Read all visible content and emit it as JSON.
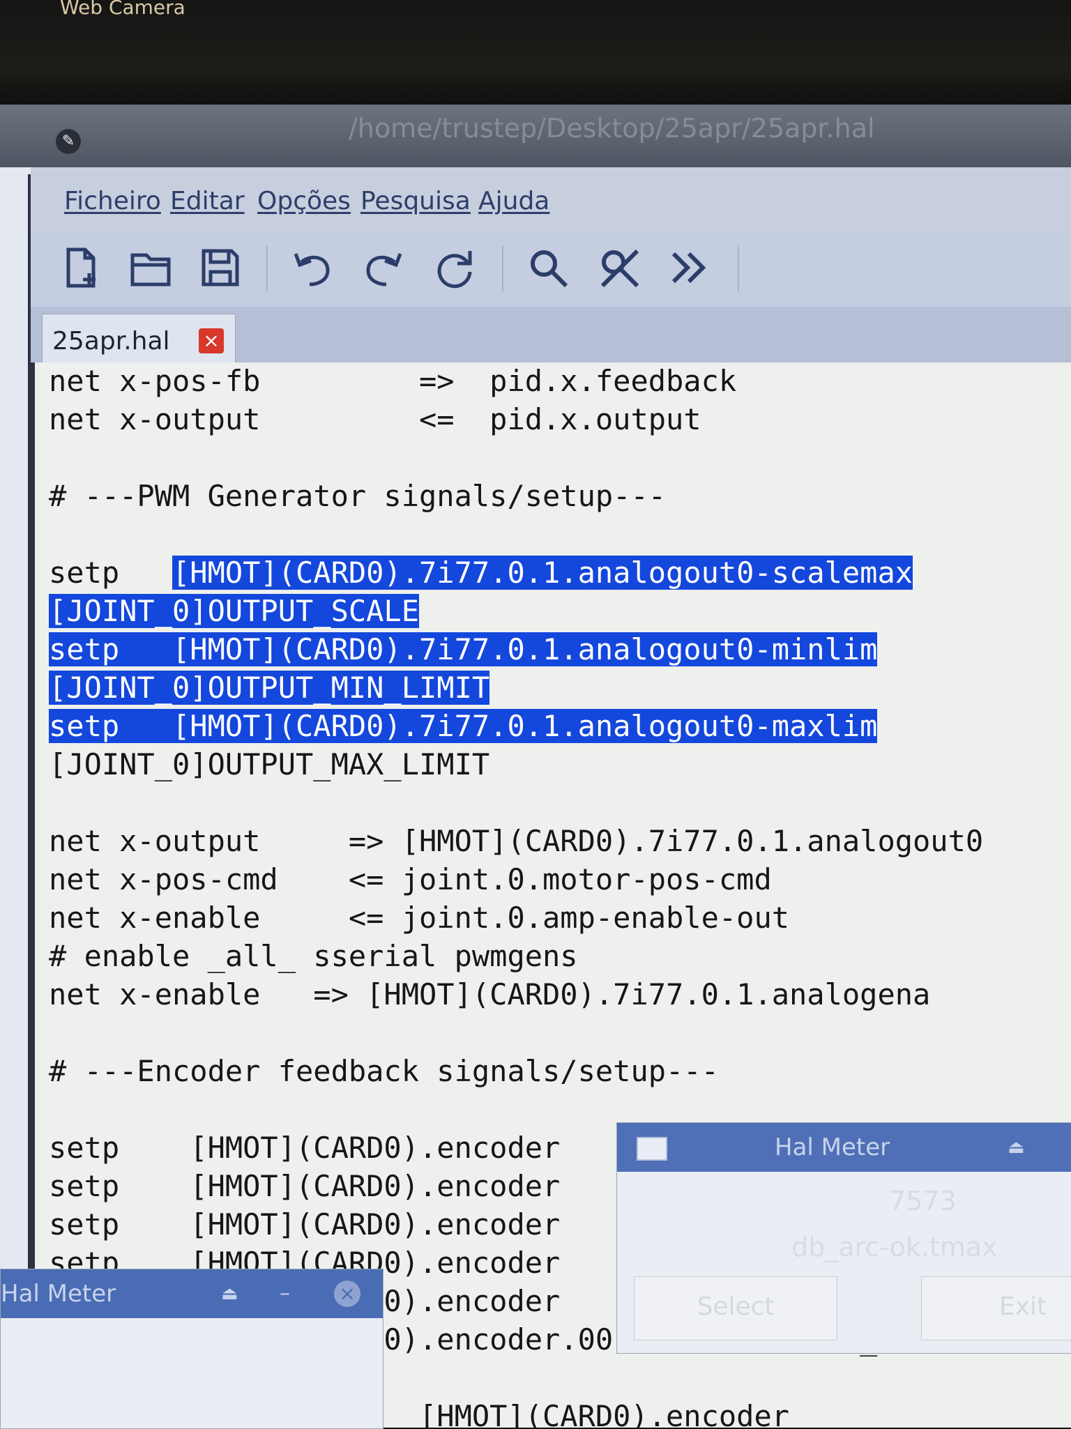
{
  "camera_label": "Web Camera",
  "window_title": "/home/trustep/Desktop/25apr/25apr.hal",
  "menu": [
    "Ficheiro",
    "Editar",
    "Opções",
    "Pesquisa",
    "Ajuda"
  ],
  "tab": {
    "label": "25apr.hal",
    "close": "×"
  },
  "editor_lines": [
    {
      "text": "net x-pos-fb         =>  pid.x.feedback"
    },
    {
      "text": "net x-output         <=  pid.x.output"
    },
    {
      "text": ""
    },
    {
      "text": "# ---PWM Generator signals/setup---"
    },
    {
      "text": ""
    },
    {
      "prefix": "setp   ",
      "selected": "[HMOT](CARD0).7i77.0.1.analogout0-scalemax"
    },
    {
      "prefix": "",
      "selected": "[JOINT_0]OUTPUT_SCALE"
    },
    {
      "prefix": "",
      "selected": "setp   [HMOT](CARD0).7i77.0.1.analogout0-minlim"
    },
    {
      "prefix": "",
      "selected": "[JOINT_0]OUTPUT_MIN_LIMIT"
    },
    {
      "prefix": "",
      "selected": "setp   [HMOT](CARD0).7i77.0.1.analogout0-maxlim"
    },
    {
      "text": "[JOINT_0]OUTPUT_MAX_LIMIT"
    },
    {
      "text": ""
    },
    {
      "text": "net x-output     => [HMOT](CARD0).7i77.0.1.analogout0"
    },
    {
      "text": "net x-pos-cmd    <= joint.0.motor-pos-cmd"
    },
    {
      "text": "net x-enable     <= joint.0.amp-enable-out"
    },
    {
      "text": "# enable _all_ sserial pwmgens"
    },
    {
      "text": "net x-enable   => [HMOT](CARD0).7i77.0.1.analogena"
    },
    {
      "text": ""
    },
    {
      "text": "# ---Encoder feedback signals/setup---"
    },
    {
      "text": ""
    },
    {
      "text": "setp    [HMOT](CARD0).encoder"
    },
    {
      "text": "setp    [HMOT](CARD0).encoder"
    },
    {
      "text": "setp    [HMOT](CARD0).encoder"
    },
    {
      "text": "setp    [HMOT](CARD0).encoder"
    },
    {
      "text": "        [HMOT](CARD0).encoder"
    },
    {
      "text": "        [HMOT](CARD0).encoder.00.scale  [JOINT_0]ENC"
    },
    {
      "text": ""
    },
    {
      "text": "                 <=  [HMOT](CARD0).encoder"
    }
  ],
  "hal_meter_right": {
    "title": "Hal Meter",
    "value": "7573",
    "signal": "db_arc-ok.tmax",
    "select_label": "Select",
    "exit_label": "Exit"
  },
  "hal_meter_left": {
    "title": "Hal Meter"
  }
}
